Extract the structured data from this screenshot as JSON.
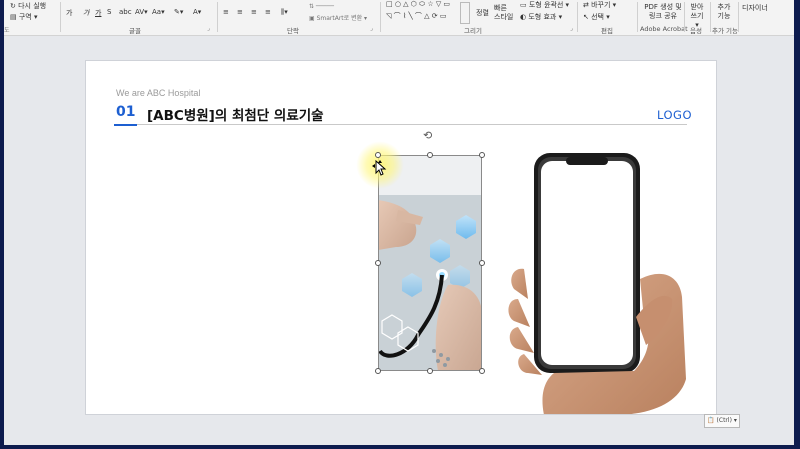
{
  "ribbon": {
    "top_left_1": "다시 실행",
    "top_left_2": "구역",
    "top_left_3": "도",
    "font_group_label": "글꼴",
    "paragraph_group_label": "단락",
    "smartart_label": "SmartArt로 변환",
    "drawing_group_label": "그리기",
    "arrange_label": "정렬",
    "quick_styles_label": "빠른 스타일",
    "shape_fill_label": "도형 윤곽선",
    "shape_effect_label": "도형 효과",
    "replace_label": "바꾸기",
    "select_label": "선택",
    "edit_group_label": "편집",
    "pdf_label": "PDF 생성 및 링크 공유",
    "acrobat_group_label": "Adobe Acrobat",
    "dictate_label": "받아쓰기",
    "voice_group_label": "음성",
    "addin_label": "추가 기능",
    "addin_group_label": "추가 기능",
    "designer_label": "디자이너"
  },
  "slide": {
    "subtitle": "We are ABC Hospital",
    "number": "01",
    "title": "[ABC병원]의 최첨단 의료기술",
    "logo": "LOGO"
  },
  "paste_options": "(Ctrl)",
  "colors": {
    "accent": "#1d5fd1",
    "frame": "#0d1b4e"
  }
}
